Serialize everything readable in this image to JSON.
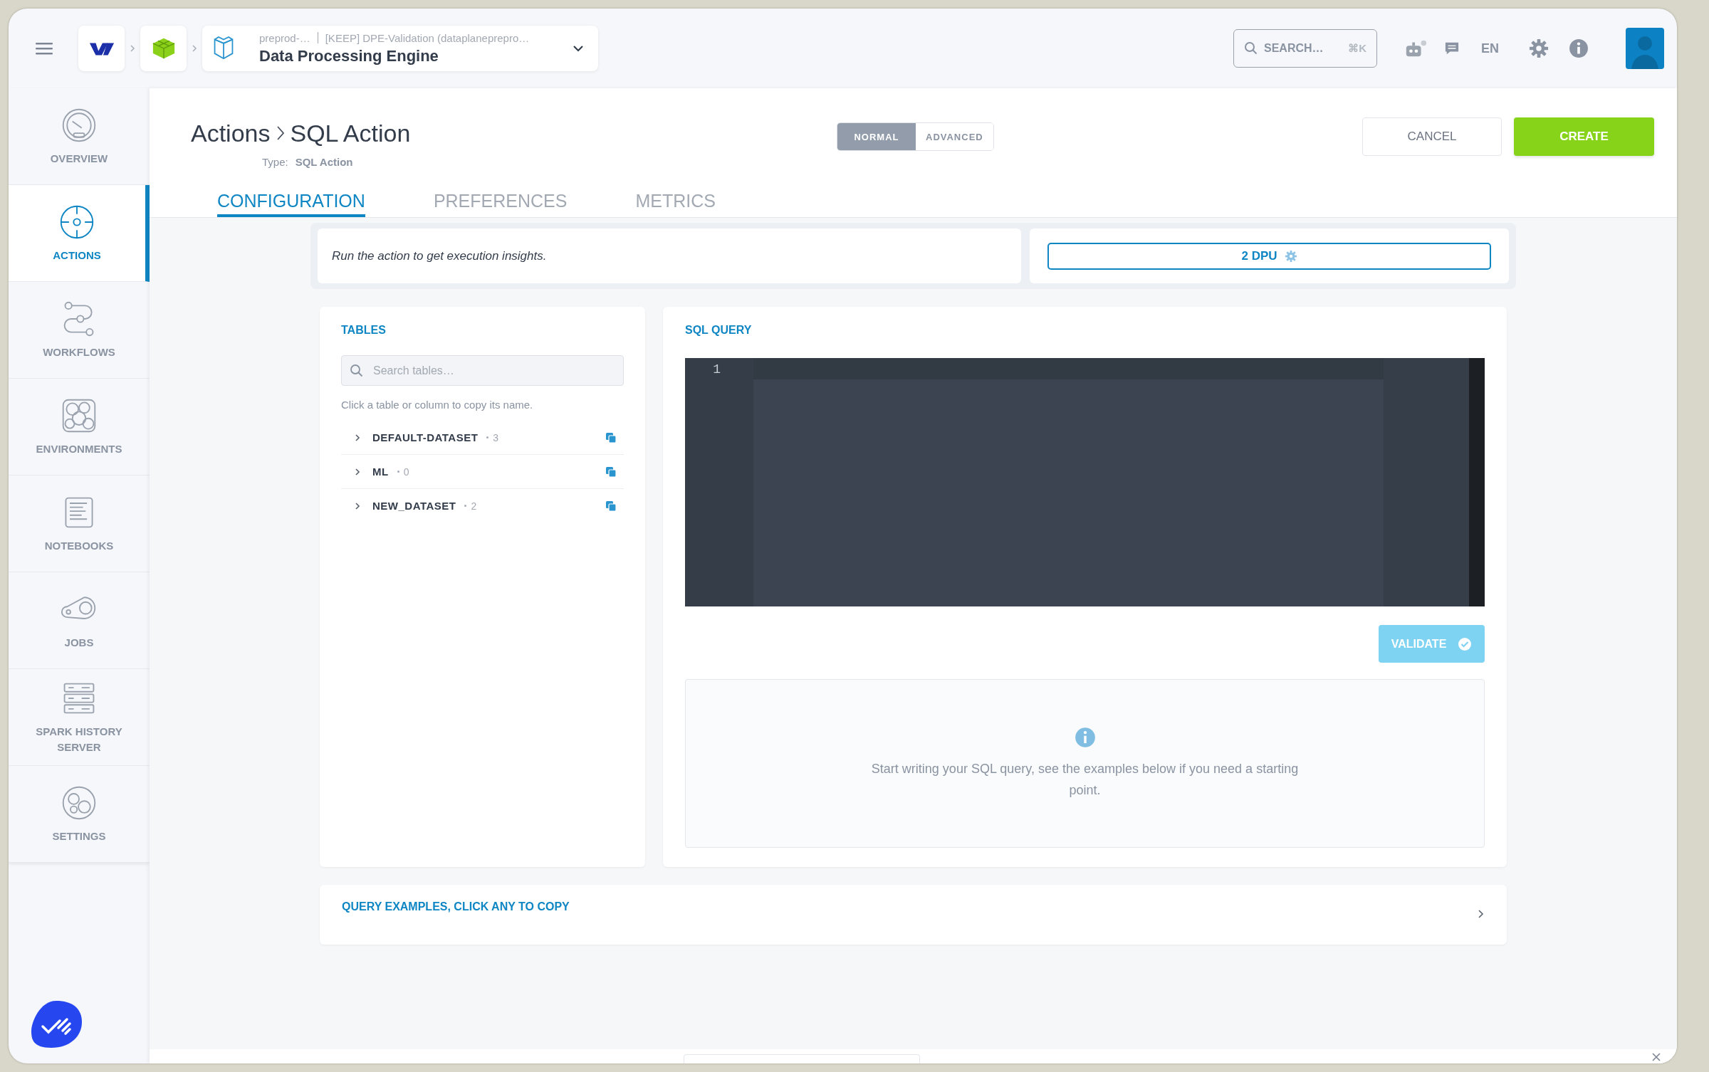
{
  "topbar": {
    "project_org": "preprod-…",
    "project_name": "[KEEP] DPE-Validation (dataplanepreprо…",
    "app_title": "Data Processing Engine",
    "search": {
      "placeholder": "SEARCH…",
      "shortcut": "⌘K"
    },
    "language": "EN"
  },
  "sidebar": {
    "items": [
      {
        "label": "OVERVIEW",
        "selected": false
      },
      {
        "label": "ACTIONS",
        "selected": true
      },
      {
        "label": "WORKFLOWS",
        "selected": false
      },
      {
        "label": "ENVIRONMENTS",
        "selected": false
      },
      {
        "label": "NOTEBOOKS",
        "selected": false
      },
      {
        "label": "JOBS",
        "selected": false
      },
      {
        "label": "SPARK HISTORY SERVER",
        "selected": false
      },
      {
        "label": "SETTINGS",
        "selected": false
      }
    ]
  },
  "header": {
    "breadcrumb": [
      "Actions",
      "SQL Action"
    ],
    "type_label": "Type:",
    "type_value": "SQL Action",
    "mode_toggle": [
      {
        "label": "NORMAL",
        "selected": true
      },
      {
        "label": "ADVANCED",
        "selected": false
      }
    ],
    "cancel": "CANCEL",
    "create": "CREATE",
    "tabs": [
      {
        "label": "CONFIGURATION",
        "selected": true
      },
      {
        "label": "PREFERENCES",
        "selected": false
      },
      {
        "label": "METRICS",
        "selected": false
      }
    ]
  },
  "insights": {
    "text": "Run the action to get execution insights.",
    "dpu": "2 DPU"
  },
  "tables": {
    "title": "TABLES",
    "search": {
      "placeholder": "Search tables…"
    },
    "hint": "Click a table or column to copy its name.",
    "items": [
      {
        "name": "DEFAULT-DATASET",
        "count": "3",
        "expanded": false
      },
      {
        "name": "ML",
        "count": "0",
        "expanded": false
      },
      {
        "name": "NEW_DATASET",
        "count": "2",
        "expanded": false
      }
    ]
  },
  "sql_query": {
    "title": "SQL QUERY",
    "line_numbers": [
      "1"
    ],
    "validate": {
      "label": "VALIDATE",
      "disabled": true
    },
    "info_text": "Start writing your SQL query, see the examples below if you need a starting point."
  },
  "query_examples": {
    "title": "QUERY EXAMPLES, CLICK ANY TO COPY",
    "expanded": false
  }
}
